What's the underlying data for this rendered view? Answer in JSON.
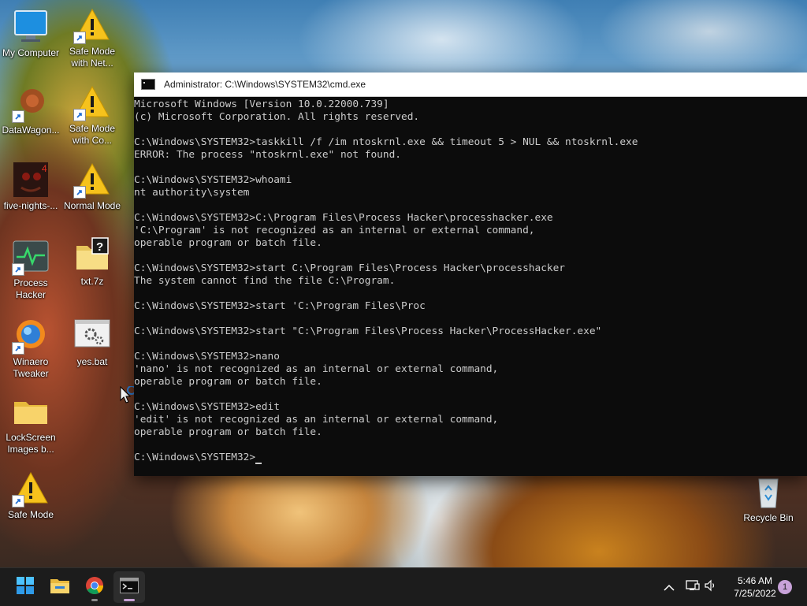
{
  "desktop": {
    "icons": [
      {
        "label": "My Computer",
        "icon": "monitor-icon"
      },
      {
        "label": "Safe Mode with Net...",
        "icon": "warning-icon"
      },
      {
        "label": "DataWagon...",
        "icon": "app-icon"
      },
      {
        "label": "Safe Mode with Co...",
        "icon": "warning-icon"
      },
      {
        "label": "five-nights-...",
        "icon": "game-icon"
      },
      {
        "label": "Normal Mode",
        "icon": "warning-icon"
      },
      {
        "label": "Process Hacker",
        "icon": "process-hacker-icon"
      },
      {
        "label": "txt.7z",
        "icon": "archive-icon"
      },
      {
        "label": "Winaero Tweaker",
        "icon": "winaero-icon"
      },
      {
        "label": "yes.bat",
        "icon": "batch-file-icon"
      },
      {
        "label": "LockScreen Images b...",
        "icon": "folder-icon"
      },
      {
        "label": "Safe Mode",
        "icon": "warning-icon"
      },
      {
        "label": "Recycle Bin",
        "icon": "recycle-bin-icon"
      }
    ]
  },
  "cmd": {
    "title": "Administrator: C:\\Windows\\SYSTEM32\\cmd.exe",
    "lines": [
      "Microsoft Windows [Version 10.0.22000.739]",
      "(c) Microsoft Corporation. All rights reserved.",
      "",
      "C:\\Windows\\SYSTEM32>taskkill /f /im ntoskrnl.exe && timeout 5 > NUL && ntoskrnl.exe",
      "ERROR: The process \"ntoskrnl.exe\" not found.",
      "",
      "C:\\Windows\\SYSTEM32>whoami",
      "nt authority\\system",
      "",
      "C:\\Windows\\SYSTEM32>C:\\Program Files\\Process Hacker\\processhacker.exe",
      "'C:\\Program' is not recognized as an internal or external command,",
      "operable program or batch file.",
      "",
      "C:\\Windows\\SYSTEM32>start C:\\Program Files\\Process Hacker\\processhacker",
      "The system cannot find the file C:\\Program.",
      "",
      "C:\\Windows\\SYSTEM32>start 'C:\\Program Files\\Proc",
      "",
      "C:\\Windows\\SYSTEM32>start \"C:\\Program Files\\Process Hacker\\ProcessHacker.exe\"",
      "",
      "C:\\Windows\\SYSTEM32>nano",
      "'nano' is not recognized as an internal or external command,",
      "operable program or batch file.",
      "",
      "C:\\Windows\\SYSTEM32>edit",
      "'edit' is not recognized as an internal or external command,",
      "operable program or batch file.",
      ""
    ],
    "prompt": "C:\\Windows\\SYSTEM32>"
  },
  "taskbar": {
    "items": [
      "start-icon",
      "file-explorer-icon",
      "chrome-icon",
      "cmd-icon"
    ],
    "tray": [
      "chevron-up-icon",
      "network-icon",
      "volume-icon"
    ],
    "time": "5:46 AM",
    "date": "7/25/2022",
    "notification_count": "1"
  }
}
